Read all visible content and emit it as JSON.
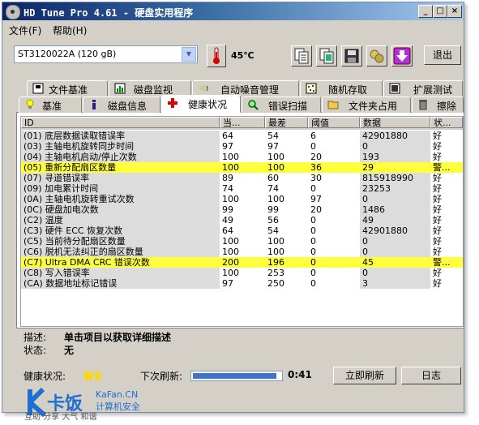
{
  "window": {
    "title": "HD Tune Pro 4.61 - 硬盘实用程序",
    "minimize": "_",
    "maximize": "□",
    "close": "×"
  },
  "menu": [
    "文件(F)",
    "帮助(H)"
  ],
  "toolbar": {
    "drive": "ST3120022A (120 gB)",
    "temperature": "45℃",
    "exit_label": "退出",
    "buttons": [
      "copy-text-icon",
      "copy-screenshot-icon",
      "save-icon",
      "options-icon",
      "download-icon"
    ]
  },
  "tabs_top": [
    "文件基准",
    "磁盘监视",
    "自动噪音管理",
    "随机存取",
    "扩展测试"
  ],
  "tabs_bottom": [
    "基准",
    "磁盘信息",
    "健康状况",
    "错误扫描",
    "文件夹占用",
    "擦除"
  ],
  "active_tab": "健康状况",
  "table": {
    "columns": [
      "ID",
      "当...",
      "最差",
      "阈值",
      "数据",
      "状..."
    ],
    "rows": [
      {
        "id": "(01) 底层数据读取错误率",
        "current": "64",
        "worst": "54",
        "threshold": "6",
        "data": "42901880",
        "status": "好",
        "warn": false
      },
      {
        "id": "(03) 主轴电机旋转同步时间",
        "current": "97",
        "worst": "97",
        "threshold": "0",
        "data": "0",
        "status": "好",
        "warn": false
      },
      {
        "id": "(04) 主轴电机启动/停止次数",
        "current": "100",
        "worst": "100",
        "threshold": "20",
        "data": "193",
        "status": "好",
        "warn": false
      },
      {
        "id": "(05) 重新分配扇区数量",
        "current": "100",
        "worst": "100",
        "threshold": "36",
        "data": "29",
        "status": "警...",
        "warn": true
      },
      {
        "id": "(07) 寻道错误率",
        "current": "89",
        "worst": "60",
        "threshold": "30",
        "data": "815918990",
        "status": "好",
        "warn": false
      },
      {
        "id": "(09) 加电累计时间",
        "current": "74",
        "worst": "74",
        "threshold": "0",
        "data": "23253",
        "status": "好",
        "warn": false
      },
      {
        "id": "(0A) 主轴电机旋转重试次数",
        "current": "100",
        "worst": "100",
        "threshold": "97",
        "data": "0",
        "status": "好",
        "warn": false
      },
      {
        "id": "(0C) 硬盘加电次数",
        "current": "99",
        "worst": "99",
        "threshold": "20",
        "data": "1486",
        "status": "好",
        "warn": false
      },
      {
        "id": "(C2) 温度",
        "current": "49",
        "worst": "56",
        "threshold": "0",
        "data": "49",
        "status": "好",
        "warn": false
      },
      {
        "id": "(C3) 硬件 ECC 恢复次数",
        "current": "64",
        "worst": "54",
        "threshold": "0",
        "data": "42901880",
        "status": "好",
        "warn": false
      },
      {
        "id": "(C5) 当前待分配扇区数量",
        "current": "100",
        "worst": "100",
        "threshold": "0",
        "data": "0",
        "status": "好",
        "warn": false
      },
      {
        "id": "(C6) 脱机无法纠正的扇区数量",
        "current": "100",
        "worst": "100",
        "threshold": "0",
        "data": "0",
        "status": "好",
        "warn": false
      },
      {
        "id": "(C7) Ultra DMA CRC 错误次数",
        "current": "200",
        "worst": "196",
        "threshold": "0",
        "data": "45",
        "status": "警...",
        "warn": true
      },
      {
        "id": "(C8) 写入错误率",
        "current": "100",
        "worst": "253",
        "threshold": "0",
        "data": "0",
        "status": "好",
        "warn": false
      },
      {
        "id": "(CA) 数据地址标记错误",
        "current": "97",
        "worst": "250",
        "threshold": "0",
        "data": "3",
        "status": "好",
        "warn": false
      }
    ]
  },
  "details": {
    "desc_label": "描述:",
    "desc_value": "单击项目以获取详细描述",
    "state_label": "状态:",
    "state_value": "无"
  },
  "status": {
    "health_label": "健康状况:",
    "health_value": "警告",
    "health_color": "#ffd700",
    "refresh_label": "下次刷新:",
    "refresh_progress": 0.95,
    "countdown": "0:41",
    "refresh_button": "立即刷新",
    "log_button": "日志"
  },
  "watermark": {
    "brand": "卡饭",
    "site": "KaFan.CN",
    "slogan": "计算机安全",
    "scribble": "互助 分享   大气 和谐"
  }
}
